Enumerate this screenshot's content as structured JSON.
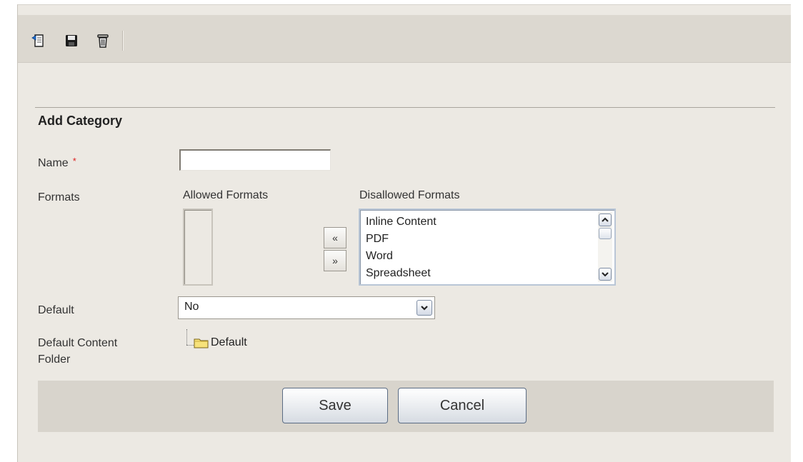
{
  "toolbar": {
    "icons": [
      "back-page-icon",
      "save-icon",
      "trash-icon"
    ]
  },
  "form": {
    "title": "Add Category",
    "name_label": "Name",
    "required_marker": "*",
    "name_value": "",
    "formats_label": "Formats",
    "allowed_heading": "Allowed Formats",
    "disallowed_heading": "Disallowed Formats",
    "move_left": "«",
    "move_right": "»",
    "disallowed_items": [
      "Inline Content",
      "PDF",
      "Word",
      "Spreadsheet"
    ],
    "default_label": "Default",
    "default_value": "No",
    "folder_label_line1": "Default Content",
    "folder_label_line2": "Folder",
    "folder_node": "Default"
  },
  "actions": {
    "save": "Save",
    "cancel": "Cancel"
  },
  "colors": {
    "panel": "#ece9e3",
    "toolbar": "#dcd8d0",
    "required": "#dd2222"
  }
}
